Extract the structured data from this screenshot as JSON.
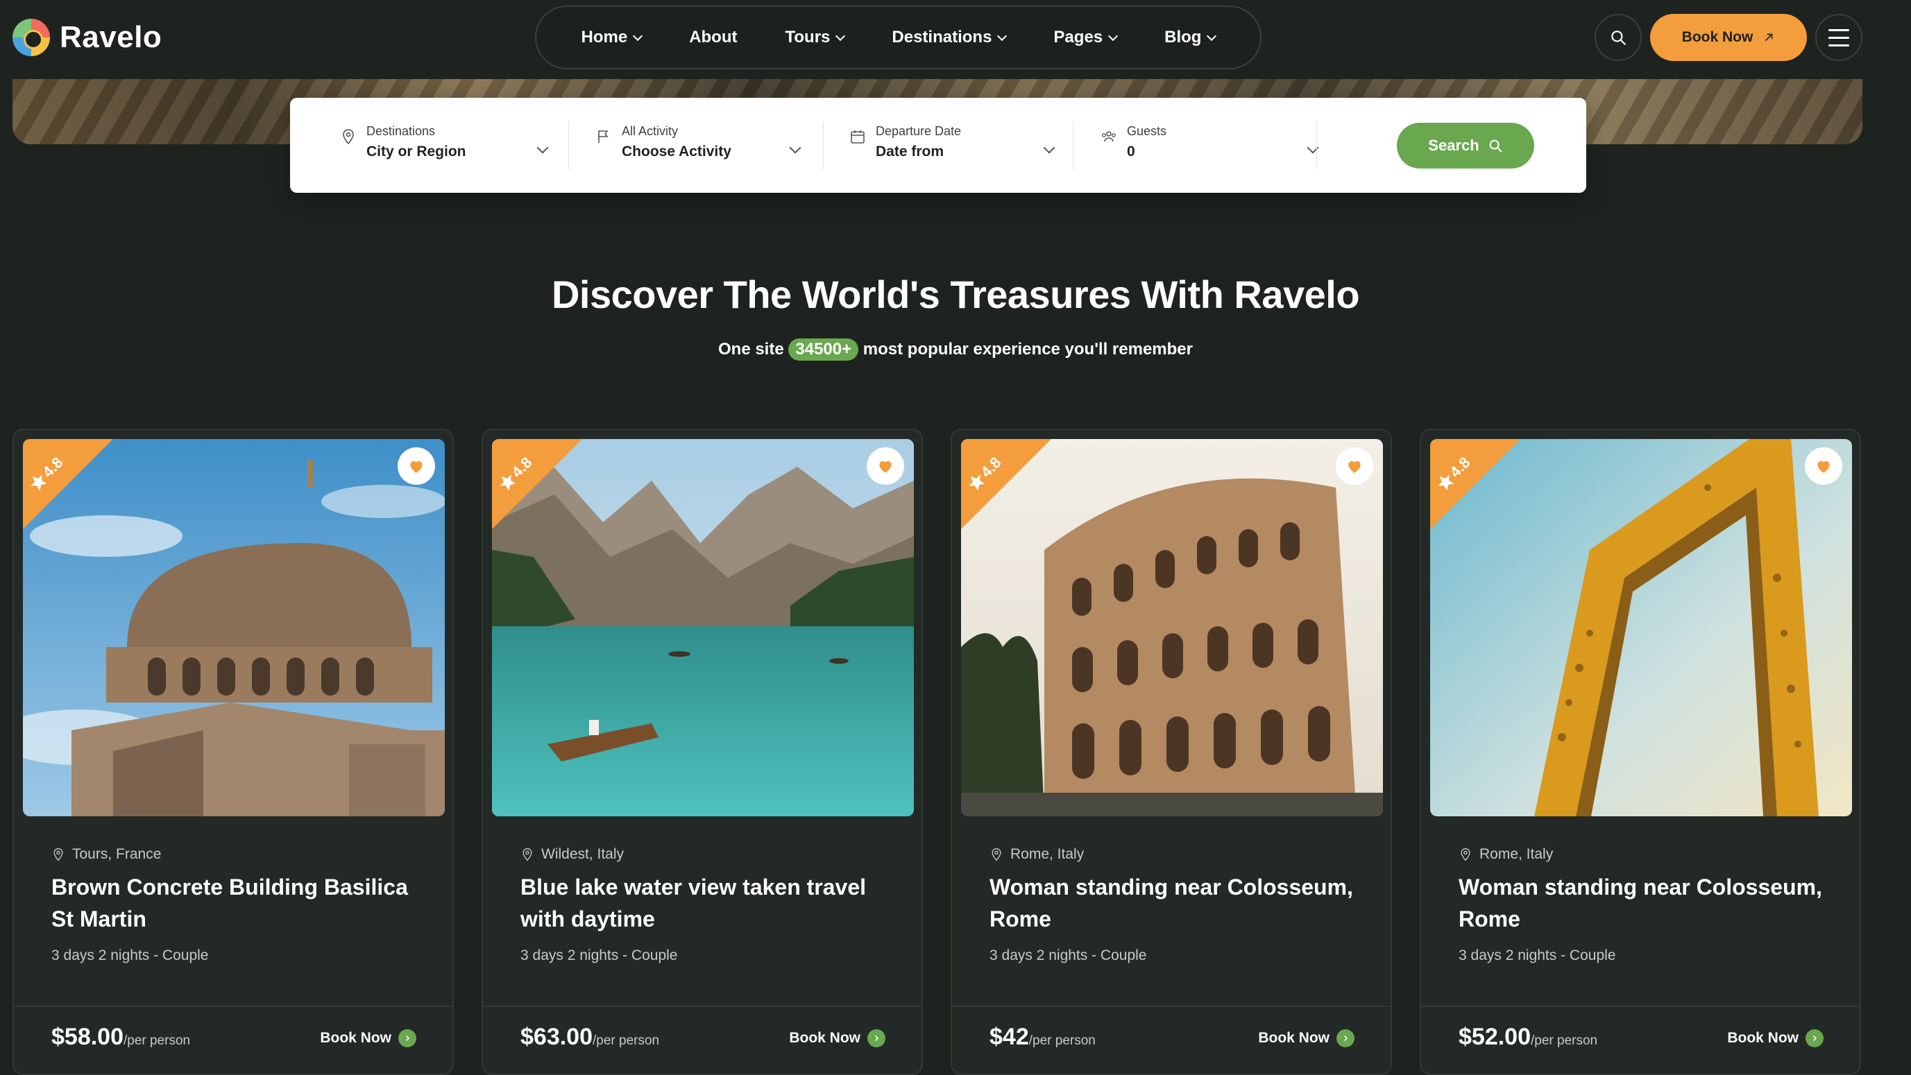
{
  "brand": {
    "name": "Ravelo"
  },
  "nav": {
    "items": [
      {
        "label": "Home",
        "dropdown": true
      },
      {
        "label": "About",
        "dropdown": false
      },
      {
        "label": "Tours",
        "dropdown": true
      },
      {
        "label": "Destinations",
        "dropdown": true
      },
      {
        "label": "Pages",
        "dropdown": true
      },
      {
        "label": "Blog",
        "dropdown": true
      }
    ]
  },
  "header": {
    "book_label": "Book Now"
  },
  "search": {
    "destination_label": "Destinations",
    "destination_value": "City or Region",
    "activity_label": "All Activity",
    "activity_value": "Choose Activity",
    "date_label": "Departure Date",
    "date_value": "Date from",
    "guests_label": "Guests",
    "guests_value": "0",
    "button_label": "Search"
  },
  "section": {
    "title": "Discover The World's Treasures With Ravelo",
    "subtitle_pre": "One site",
    "subtitle_count": "34500+",
    "subtitle_post": "most popular experience you'll remember"
  },
  "cards": [
    {
      "rating": "4.8",
      "location": "Tours, France",
      "title": "Brown Concrete Building Basilica St Martin",
      "meta": "3 days 2 nights - Couple",
      "price": "$58.00",
      "per": "/per person",
      "book": "Book Now"
    },
    {
      "rating": "4.8",
      "location": "Wildest, Italy",
      "title": "Blue lake water view taken travel with daytime",
      "meta": "3 days 2 nights - Couple",
      "price": "$63.00",
      "per": "/per person",
      "book": "Book Now"
    },
    {
      "rating": "4.8",
      "location": "Rome, Italy",
      "title": "Woman standing near Colosseum, Rome",
      "meta": "3 days 2 nights - Couple",
      "price": "$42",
      "per": "/per person",
      "book": "Book Now"
    },
    {
      "rating": "4.8",
      "location": "Rome, Italy",
      "title": "Woman standing near Colosseum, Rome",
      "meta": "3 days 2 nights - Couple",
      "price": "$52.00",
      "per": "/per person",
      "book": "Book Now"
    }
  ],
  "colors": {
    "accent": "#f39d3d",
    "green": "#6aa84f",
    "background": "#1e2320"
  }
}
